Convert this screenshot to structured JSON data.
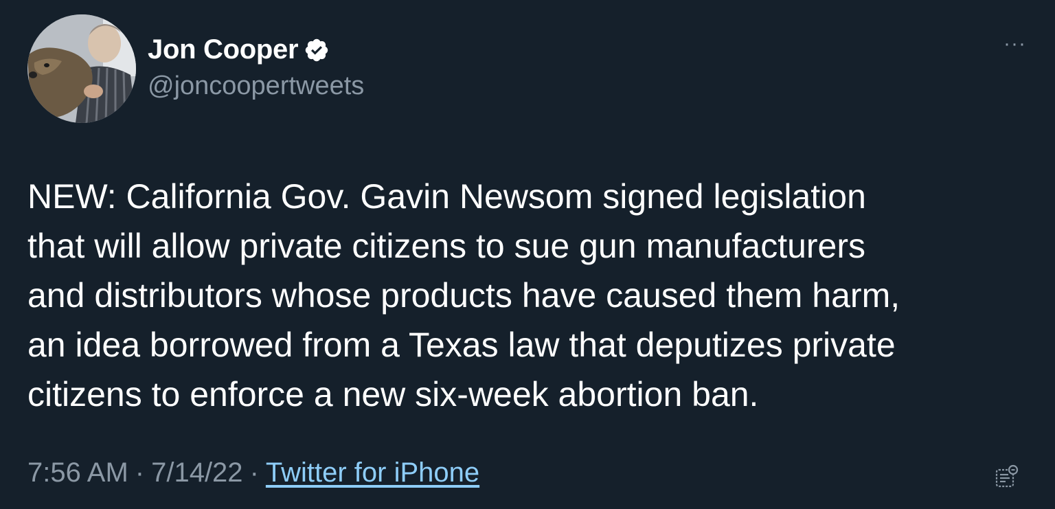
{
  "author": {
    "display_name": "Jon Cooper",
    "handle": "@joncoopertweets",
    "verified": true,
    "verified_icon": "verified-badge-icon",
    "avatar_icon": "profile-photo-man-with-dog"
  },
  "more_icon": "more-options-icon",
  "more_glyph": "···",
  "tweet": {
    "lines": [
      "NEW: California Gov. Gavin Newsom signed legislation",
      "that will allow private citizens to sue gun manufacturers",
      "and distributors whose products have caused them harm,",
      "an idea borrowed from a Texas law that deputizes private",
      "citizens to enforce a new six-week abortion ban."
    ]
  },
  "meta": {
    "time": "7:56 AM",
    "separator": "·",
    "date": "7/14/22",
    "source": "Twitter for iPhone"
  },
  "analytics_icon": "tweet-analytics-icon",
  "colors": {
    "background": "#15202b",
    "primary_text": "#ffffff",
    "secondary_text": "#8b98a5",
    "link": "#8ecdf8"
  }
}
